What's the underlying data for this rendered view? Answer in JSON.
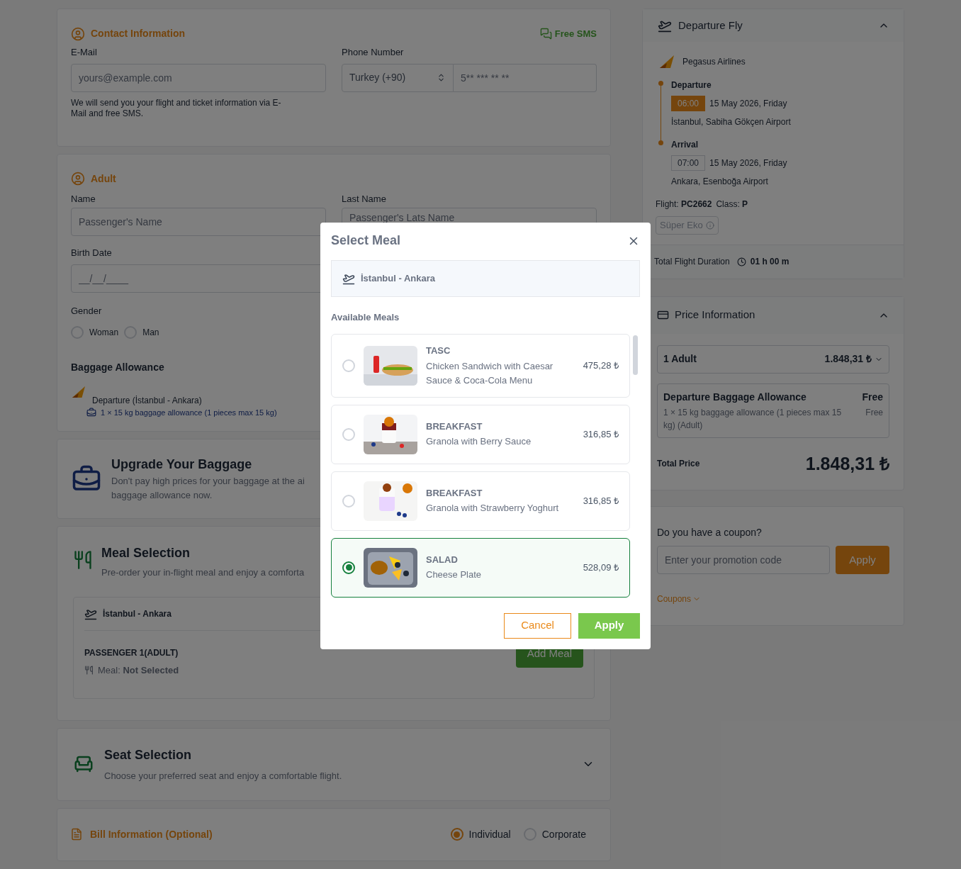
{
  "contact": {
    "title": "Contact Information",
    "sms_badge": "Free SMS",
    "email_label": "E-Mail",
    "email_placeholder": "yours@example.com",
    "note": "We will send you your flight and ticket information via E-Mail and free SMS.",
    "phone_label": "Phone Number",
    "country": "Turkey (+90)",
    "phone_placeholder": "5** *** ** **"
  },
  "adult": {
    "title": "Adult",
    "name_label": "Name",
    "name_placeholder": "Passenger's Name",
    "last_name_label": "Last Name",
    "last_name_placeholder": "Passenger's Lats Name",
    "birth_label": "Birth Date",
    "birth_placeholder": "__/__/____",
    "gender_label": "Gender",
    "genders": [
      {
        "label": "Woman",
        "selected": false
      },
      {
        "label": "Man",
        "selected": false
      }
    ],
    "baggage_title": "Baggage Allowance",
    "baggage_route": "Departure (İstanbul - Ankara)",
    "baggage_detail": "1 × 15 kg baggage allowance (1 pieces max 15 kg)"
  },
  "upgrade": {
    "title": "Upgrade Your Baggage",
    "lines": [
      "Don't pay high prices for your baggage at the ai",
      "baggage allowance now."
    ]
  },
  "meal_section": {
    "title": "Meal Selection",
    "text": "Pre-order your in-flight meal and enjoy a comforta",
    "route": "İstanbul - Ankara",
    "passenger": "PASSENGER 1(ADULT)",
    "meal_label": "Meal:",
    "meal_value": "Not Selected",
    "button": "Add Meal"
  },
  "seat": {
    "title": "Seat Selection",
    "text": "Choose your preferred seat and enjoy a comfortable flight.",
    "expanded": false
  },
  "bill": {
    "title": "Bill Information (Optional)",
    "options": [
      {
        "label": "Individual",
        "selected": true
      },
      {
        "label": "Corporate",
        "selected": false
      }
    ]
  },
  "flight": {
    "title": "Departure Fly",
    "expanded": true,
    "airline": "Pegasus Airlines",
    "stops": [
      {
        "label": "Departure",
        "time": "06:00",
        "date": "15 May 2026, Friday",
        "airport": "İstanbul, Sabiha Gökçen Airport",
        "highlighted": true
      },
      {
        "label": "Arrival",
        "time": "07:00",
        "date": "15 May 2026, Friday",
        "airport": "Ankara, Esenboğa Airport",
        "highlighted": false
      }
    ],
    "flight_label": "Flight:",
    "flight_no": "PC2662",
    "class_label": "Class:",
    "class": "P",
    "fare": "Süper Eko",
    "duration_label": "Total Flight Duration",
    "duration": "01 h 00 m"
  },
  "price": {
    "title": "Price Information",
    "expanded": true,
    "passenger": "1 Adult",
    "passenger_price": "1.848,31 ₺",
    "extra_title": "Departure Baggage Allowance",
    "extra_price": "Free",
    "extra_detail": "1 × 15 kg baggage allowance (1 pieces max 15 kg) (Adult)",
    "extra_detail_price": "Free",
    "total_label": "Total Price",
    "total": "1.848,31 ₺"
  },
  "coupon": {
    "question": "Do you have a coupon?",
    "placeholder": "Enter your promotion code",
    "button": "Apply",
    "link": "Coupons"
  },
  "modal": {
    "title": "Select Meal",
    "route": "İstanbul - Ankara",
    "list_title": "Available Meals",
    "meals": [
      {
        "category": "TASC",
        "name": "Chicken Sandwich with Caesar Sauce & Coca-Cola Menu",
        "price": "475,28 ₺",
        "selected": false
      },
      {
        "category": "BREAKFAST",
        "name": "Granola with Berry Sauce",
        "price": "316,85 ₺",
        "selected": false
      },
      {
        "category": "BREAKFAST",
        "name": "Granola with Strawberry Yoghurt",
        "price": "316,85 ₺",
        "selected": false
      },
      {
        "category": "SALAD",
        "name": "Cheese Plate",
        "price": "528,09 ₺",
        "selected": true
      }
    ],
    "cancel": "Cancel",
    "apply": "Apply"
  }
}
